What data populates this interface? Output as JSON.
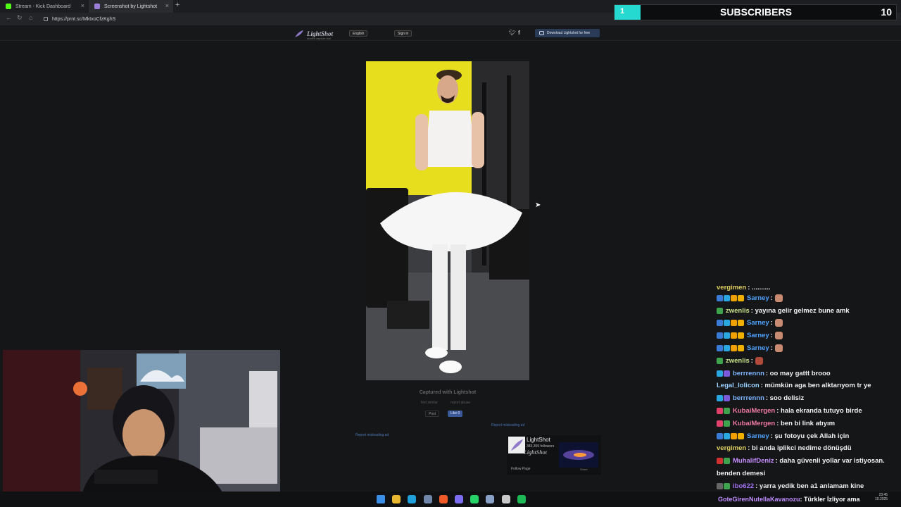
{
  "browser": {
    "tabs": [
      {
        "label": "Stream - Kick Dashboard",
        "fav_color": "#53fc18"
      },
      {
        "label": "Screenshot by Lightshot",
        "fav_color": "#9b7fd6"
      }
    ],
    "url": "https://prnt.sc/MktxoCfzKghS"
  },
  "overlay": {
    "subscribers_label": "SUBSCRIBERS",
    "current": "1",
    "goal": "10",
    "accent": "#25d9d1"
  },
  "lightshot": {
    "logo": "LightShot",
    "tagline": "screen capture tool",
    "language": "English",
    "signin": "Sign in",
    "download": "Download Lightshot for free",
    "captured": "Captured with Lightshot",
    "find_similar": "find similar",
    "report_abuse": "report abuse",
    "post": "Post",
    "like": "Like 0",
    "report_ad": "Report misleading ad",
    "fb_widget": {
      "name": "LightShot",
      "followers": "383,359 followers",
      "follow": "Follow Page",
      "share": "Share",
      "logo_text": "LightShot"
    }
  },
  "chat": [
    {
      "user": "vergimen",
      "color": "#e0d060",
      "text": ": ..........",
      "badges": []
    },
    {
      "user": "Sarney",
      "color": "#4fa3ff",
      "text": ":",
      "badges": [
        "#3b7bd8",
        "#2aa6e0",
        "#f0a000",
        "#f0b000"
      ],
      "emote": "#c88a70"
    },
    {
      "user": "zwenlis",
      "color": "#c9e08a",
      "text": ": yayına gelir gelmez bune amk",
      "badges": [
        "#3fa34d"
      ]
    },
    {
      "user": "Sarney",
      "color": "#4fa3ff",
      "text": ":",
      "badges": [
        "#3b7bd8",
        "#2aa6e0",
        "#f0a000",
        "#f0b000"
      ],
      "emote": "#c88a70"
    },
    {
      "user": "Sarney",
      "color": "#4fa3ff",
      "text": ":",
      "badges": [
        "#3b7bd8",
        "#2aa6e0",
        "#f0a000",
        "#f0b000"
      ],
      "emote": "#c88a70"
    },
    {
      "user": "Sarney",
      "color": "#4fa3ff",
      "text": ":",
      "badges": [
        "#3b7bd8",
        "#2aa6e0",
        "#f0a000",
        "#f0b000"
      ],
      "emote": "#c88a70"
    },
    {
      "user": "zwenlis",
      "color": "#c9e08a",
      "text": ":",
      "badges": [
        "#3fa34d"
      ],
      "emote": "#b04a3a"
    },
    {
      "user": "berrrennn",
      "color": "#7fb6ff",
      "text": ": oo may gattt brooo",
      "badges": [
        "#2aa6e0",
        "#7a5ad8"
      ]
    },
    {
      "user": "Legal_lolicon",
      "color": "#9ad0ff",
      "text": ": mümkün aga ben alktarıyom tr ye",
      "badges": []
    },
    {
      "user": "berrrennn",
      "color": "#7fb6ff",
      "text": ": soo delisiz",
      "badges": [
        "#2aa6e0",
        "#7a5ad8"
      ]
    },
    {
      "user": "KubaiMergen",
      "color": "#f07aa0",
      "text": ": hala ekranda tutuyo birde",
      "badges": [
        "#e0406a",
        "#3fa34d"
      ]
    },
    {
      "user": "KubaiMergen",
      "color": "#f07aa0",
      "text": ": ben bi link atıyım",
      "badges": [
        "#e0406a",
        "#3fa34d"
      ]
    },
    {
      "user": "Sarney",
      "color": "#4fa3ff",
      "text": ": şu fotoyu çek Allah için",
      "badges": [
        "#3b7bd8",
        "#2aa6e0",
        "#f0a000",
        "#f0b000"
      ]
    },
    {
      "user": "vergimen",
      "color": "#e0d060",
      "text": ": bi anda iplikci nedime dönüşdü",
      "badges": []
    },
    {
      "user": "MuhalifDeniz",
      "color": "#c58cff",
      "text": ": daha güvenli yollar var istiyosan.",
      "badges": [
        "#d03030",
        "#3fa34d"
      ]
    },
    {
      "user": "",
      "color": "#eeeeee",
      "text": "benden demesi",
      "badges": []
    },
    {
      "user": "ibo622",
      "color": "#a070f0",
      "text": ": yarra yedik ben a1 anlamam kine",
      "badges": [
        "#666666",
        "#3fa34d"
      ]
    }
  ],
  "ticker": {
    "user": "GoteGirenNutellaKavanozu",
    "user_color": "#c08cff",
    "text": ": Türkler İzliyor ama"
  },
  "clock": {
    "time": "23:45",
    "date": "10.2025"
  },
  "taskbar_icons": [
    {
      "name": "windows-start-icon",
      "color": "#3a8ee6"
    },
    {
      "name": "file-explorer-icon",
      "color": "#e8b730"
    },
    {
      "name": "edge-browser-icon",
      "color": "#1fa0d8"
    },
    {
      "name": "steam-icon",
      "color": "#6f86a8"
    },
    {
      "name": "brave-browser-icon",
      "color": "#f05a28"
    },
    {
      "name": "discord-icon",
      "color": "#7b6cf0"
    },
    {
      "name": "whatsapp-icon",
      "color": "#25d366"
    },
    {
      "name": "settings-icon",
      "color": "#8aa2c8"
    },
    {
      "name": "obs-icon",
      "color": "#c8c8c8"
    },
    {
      "name": "spotify-icon",
      "color": "#1db954"
    }
  ]
}
